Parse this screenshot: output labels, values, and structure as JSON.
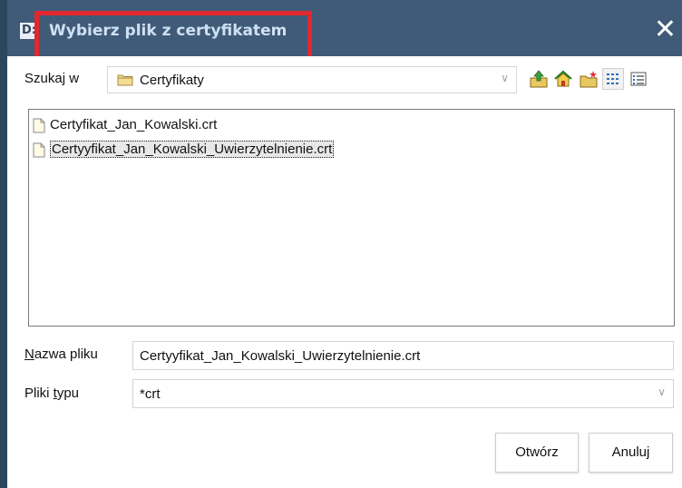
{
  "window": {
    "title": "Wybierz plik z certyfikatem",
    "icon_label": "D:",
    "close_glyph": "✕"
  },
  "look_in": {
    "label_underline": "",
    "label": "Szukaj w",
    "value": "Certyfikaty"
  },
  "toolbar": {
    "buttons": [
      "up-folder-icon",
      "home-icon",
      "new-folder-icon",
      "list-view-icon",
      "details-view-icon"
    ]
  },
  "files": [
    {
      "name": "Certyfikat_Jan_Kowalski.crt",
      "selected": false
    },
    {
      "name": "Certyyfikat_Jan_Kowalski_Uwierzytelnienie.crt",
      "selected": true
    }
  ],
  "file_name": {
    "label_first": "N",
    "label_rest": "azwa pliku",
    "value": "Certyyfikat_Jan_Kowalski_Uwierzytelnienie.crt"
  },
  "file_type": {
    "label_first": "Pliki ",
    "label_underline": "t",
    "label_rest": "ypu",
    "value": "*crt"
  },
  "buttons": {
    "open": "Otwórz",
    "cancel": "Anuluj"
  },
  "colors": {
    "titlebar": "#3f5b78",
    "title_text": "#cfe0f2",
    "highlight": "#e0282e"
  }
}
